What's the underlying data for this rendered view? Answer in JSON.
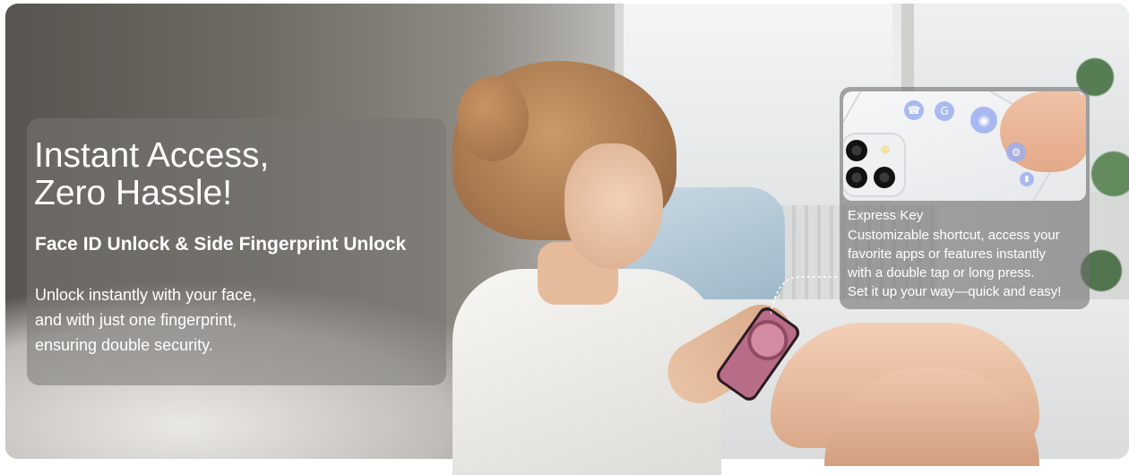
{
  "hero": {
    "headline": "Instant Access,\nZero Hassle!",
    "subheadline": "Face ID Unlock & Side Fingerprint Unlock",
    "body": "Unlock instantly with your face,\nand with just one fingerprint,\nensuring double security."
  },
  "express_key": {
    "title": "Express Key",
    "description": "Customizable shortcut, access your\nfavorite apps or features instantly\nwith a double tap or long press.\nSet it up your way—quick and easy!",
    "icons": [
      "phone-app-icon",
      "google-app-icon",
      "camera-app-icon",
      "settings-app-icon",
      "flashlight-app-icon"
    ]
  },
  "colors": {
    "text": "#ffffff",
    "panel": "rgba(120,118,115,0.55)",
    "icon_accent": "#9bafee",
    "phone_screen": "#b96c88"
  }
}
